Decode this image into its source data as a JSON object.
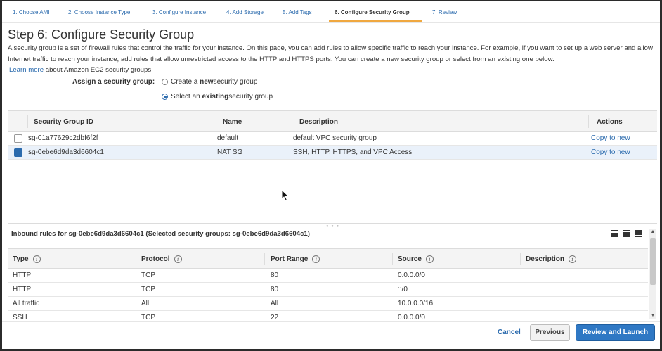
{
  "wizard": {
    "steps": [
      "1. Choose AMI",
      "2. Choose Instance Type",
      "3. Configure Instance",
      "4. Add Storage",
      "5. Add Tags",
      "6. Configure Security Group",
      "7. Review"
    ],
    "active_step": 6
  },
  "page": {
    "title": "Step 6: Configure Security Group",
    "intro": "A security group is a set of firewall rules that control the traffic for your instance. On this page, you can add rules to allow specific traffic to reach your instance. For example, if you want to set up a web server and allow Internet traffic to reach your instance, add rules that allow unrestricted access to the HTTP and HTTPS ports. You can create a new security group or select from an existing one below.",
    "learn_more": "Learn more",
    "learn_more_suffix": "about Amazon EC2 security groups."
  },
  "assign": {
    "label": "Assign a security group:",
    "option_new_prefix": "Create a ",
    "option_new_bold": "new",
    "option_new_suffix": " security group",
    "option_existing_prefix": "Select an ",
    "option_existing_bold": "existing",
    "option_existing_suffix": " security group",
    "selected": "existing"
  },
  "sg_table": {
    "columns": [
      "Security Group ID",
      "Name",
      "Description",
      "Actions"
    ],
    "rows": [
      {
        "id": "sg-01a77629c2dbf6f2f",
        "name": "default",
        "description": "default VPC security group",
        "action": "Copy to new",
        "selected": false
      },
      {
        "id": "sg-0ebe6d9da3d6604c1",
        "name": "NAT SG",
        "description": "SSH, HTTP, HTTPS, and VPC Access",
        "action": "Copy to new",
        "selected": true
      }
    ]
  },
  "inbound": {
    "title": "Inbound rules for sg-0ebe6d9da3d6604c1 (Selected security groups: sg-0ebe6d9da3d6604c1)",
    "columns": [
      "Type",
      "Protocol",
      "Port Range",
      "Source",
      "Description"
    ],
    "rows": [
      [
        "HTTP",
        "TCP",
        "80",
        "0.0.0.0/0",
        ""
      ],
      [
        "HTTP",
        "TCP",
        "80",
        "::/0",
        ""
      ],
      [
        "All traffic",
        "All",
        "All",
        "10.0.0.0/16",
        ""
      ],
      [
        "SSH",
        "TCP",
        "22",
        "0.0.0.0/0",
        ""
      ]
    ]
  },
  "footer": {
    "cancel": "Cancel",
    "previous": "Previous",
    "launch": "Review and Launch"
  },
  "colors": {
    "link": "#2a6aad",
    "primary_button": "#2f78c4",
    "active_step_underline": "#f0a840",
    "selected_row": "#eaf1fa"
  }
}
